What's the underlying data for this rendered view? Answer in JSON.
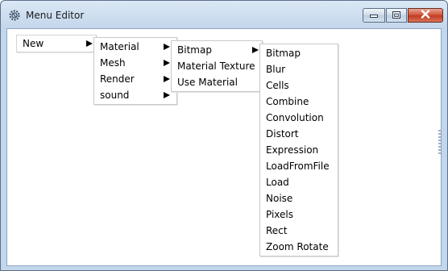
{
  "window": {
    "title": "Menu Editor"
  },
  "menus": {
    "root": {
      "items": [
        "New"
      ]
    },
    "new_submenu": {
      "items": [
        "Material",
        "Mesh",
        "Render",
        "sound"
      ]
    },
    "material_submenu": {
      "items": [
        "Bitmap",
        "Material Texture",
        "Use Material"
      ]
    },
    "bitmap_submenu": {
      "items": [
        "Bitmap",
        "Blur",
        "Cells",
        "Combine",
        "Convolution",
        "Distort",
        "Expression",
        "LoadFromFile",
        "Load",
        "Noise",
        "Pixels",
        "Rect",
        "Zoom Rotate"
      ]
    }
  },
  "icons": {
    "app": "gear-icon",
    "minimize": "minimize-icon",
    "maximize": "maximize-icon",
    "close": "close-icon",
    "submenu": "submenu-arrow-icon"
  },
  "colors": {
    "titlebar": "#c3d7ec",
    "close_button": "#c13a20",
    "menu_background": "#ffffff",
    "menu_border": "#c8c8c8"
  }
}
